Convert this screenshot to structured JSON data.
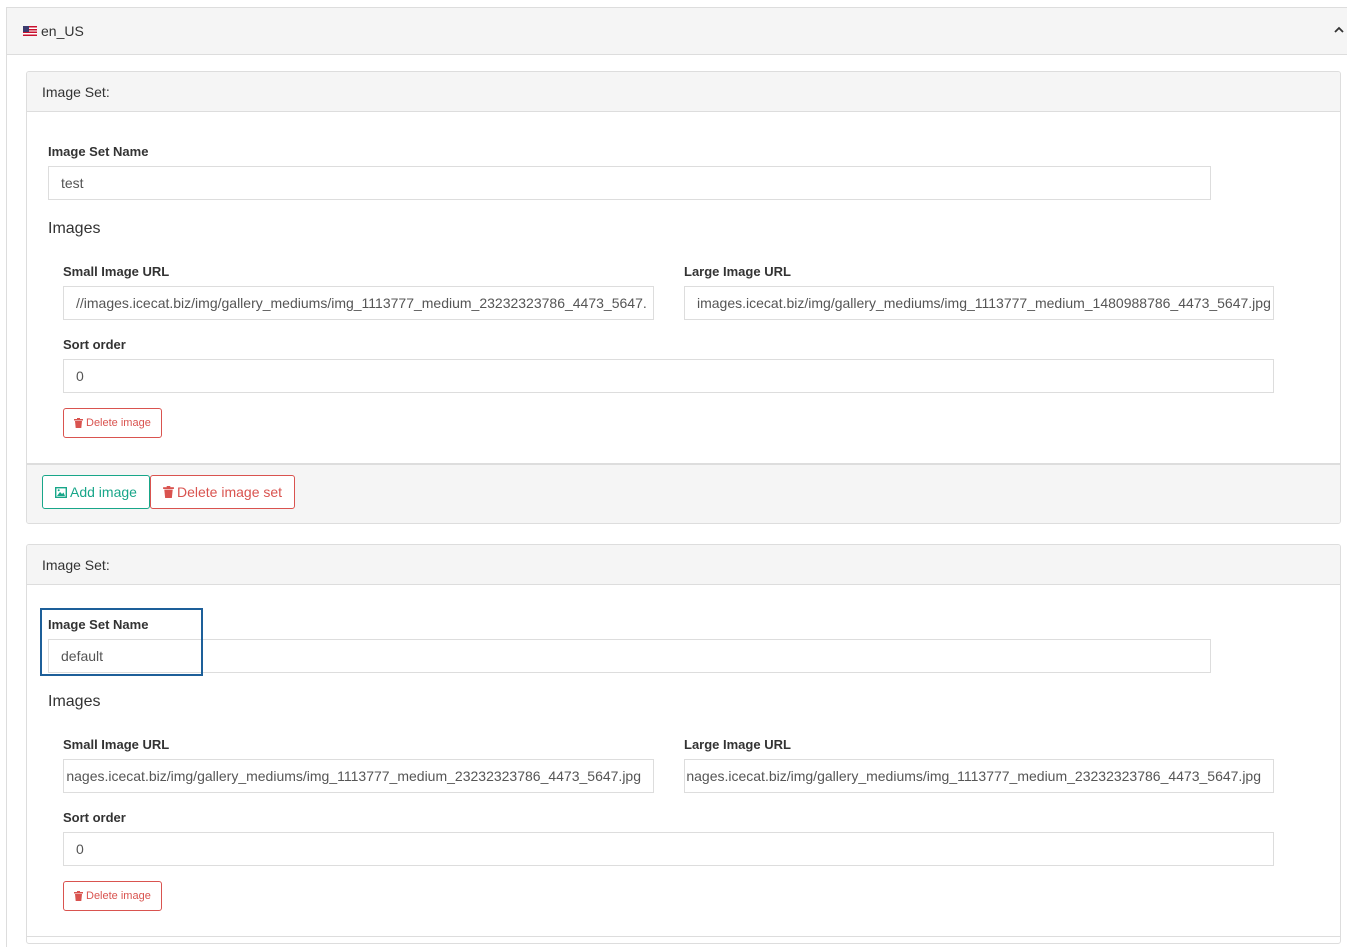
{
  "locale": {
    "label": "en_US",
    "flag_icon": "us-flag-icon",
    "collapse_icon": "chevron-up-icon"
  },
  "image_sets": [
    {
      "heading": "Image Set:",
      "name_label": "Image Set Name",
      "name_value": "test",
      "images_title": "Images",
      "images": [
        {
          "small_label": "Small Image URL",
          "small_value": "//images.icecat.biz/img/gallery_mediums/img_1113777_medium_23232323786_4473_5647.",
          "large_label": "Large Image URL",
          "large_value": "images.icecat.biz/img/gallery_mediums/img_1113777_medium_1480988786_4473_5647.jpg",
          "sort_label": "Sort order",
          "sort_value": "0",
          "delete_label": "Delete image"
        }
      ],
      "add_image_label": "Add image",
      "delete_set_label": "Delete image set"
    },
    {
      "heading": "Image Set:",
      "name_label": "Image Set Name",
      "name_value": "default",
      "images_title": "Images",
      "images": [
        {
          "small_label": "Small Image URL",
          "small_value": "nages.icecat.biz/img/gallery_mediums/img_1113777_medium_23232323786_4473_5647.jpg",
          "large_label": "Large Image URL",
          "large_value": "nages.icecat.biz/img/gallery_mediums/img_1113777_medium_23232323786_4473_5647.jpg",
          "sort_label": "Sort order",
          "sort_value": "0",
          "delete_label": "Delete image"
        }
      ]
    }
  ],
  "colors": {
    "danger": "#d9534f",
    "success": "#18a689",
    "focus": "#1d5f99"
  }
}
